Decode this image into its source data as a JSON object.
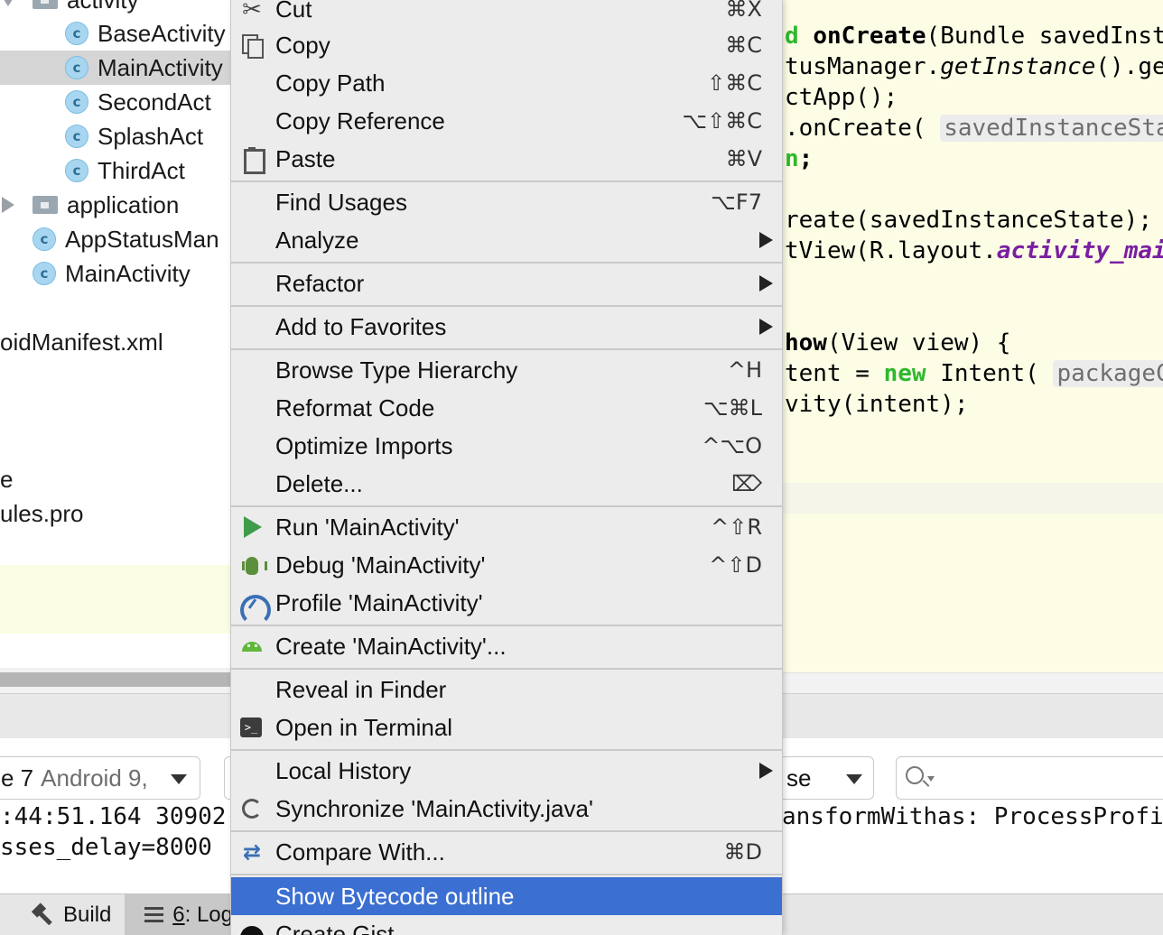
{
  "project_tree": {
    "rows": [
      {
        "label": "activity",
        "kind": "folder-open"
      },
      {
        "label": "BaseActivity",
        "kind": "class"
      },
      {
        "label": "MainActivity",
        "kind": "class"
      },
      {
        "label": "SecondAct",
        "kind": "class"
      },
      {
        "label": "SplashAct",
        "kind": "class"
      },
      {
        "label": "ThirdAct",
        "kind": "class"
      },
      {
        "label": "application",
        "kind": "folder-closed"
      },
      {
        "label": "AppStatusMan",
        "kind": "class"
      },
      {
        "label": "MainActivity",
        "kind": "class"
      },
      {
        "label": "oidManifest.xml",
        "kind": "file"
      },
      {
        "label": "e",
        "kind": "file"
      },
      {
        "label": "ules.pro",
        "kind": "file"
      }
    ],
    "class_icon_letter": "c"
  },
  "editor": {
    "lines": {
      "l1a": "d ",
      "l1b": "onCreate",
      "l1c": "(Bundle savedInst",
      "l2a": "tusManager.",
      "l2b": "getInstance",
      "l2c": "().ge",
      "l3": "ctApp();",
      "l4a": ".onCreate( ",
      "l4b": "savedInstanceState:",
      "l5a": "n",
      "l5b": ";",
      "l6": "reate(savedInstanceState);",
      "l7a": "tView(R.layout.",
      "l7b": "activity_mai",
      "l8a": "how",
      "l8b": "(View view) {",
      "l9a": "tent = ",
      "l9b": "new",
      "l9c": " Intent( ",
      "l9d": "packageC",
      "l10": "vity(intent);"
    }
  },
  "bottom_panel": {
    "device_name": "e 7",
    "device_api": "Android 9,",
    "process_label": "se",
    "log_line_1": ":44:51.164 30902-",
    "log_line_2": "sses_delay=8000",
    "log_line_right": "ansformWithas: ProcessProfi"
  },
  "toolbar": {
    "build": "Build",
    "logcat_num": "6",
    "logcat_rest": ": Log"
  },
  "context_menu": {
    "items": [
      {
        "label": "Cut",
        "shortcut": "⌘X"
      },
      {
        "label": "Copy",
        "shortcut": "⌘C"
      },
      {
        "label": "Copy Path",
        "shortcut": "⇧⌘C"
      },
      {
        "label": "Copy Reference",
        "shortcut": "⌥⇧⌘C"
      },
      {
        "label": "Paste",
        "shortcut": "⌘V"
      },
      {
        "label": "Find Usages",
        "shortcut": "⌥F7"
      },
      {
        "label": "Analyze",
        "shortcut": ""
      },
      {
        "label": "Refactor",
        "shortcut": ""
      },
      {
        "label": "Add to Favorites",
        "shortcut": ""
      },
      {
        "label": "Browse Type Hierarchy",
        "shortcut": "^H"
      },
      {
        "label": "Reformat Code",
        "shortcut": "⌥⌘L"
      },
      {
        "label": "Optimize Imports",
        "shortcut": "^⌥O"
      },
      {
        "label": "Delete...",
        "shortcut": "⌦"
      },
      {
        "label": "Run 'MainActivity'",
        "shortcut": "^⇧R"
      },
      {
        "label": "Debug 'MainActivity'",
        "shortcut": "^⇧D"
      },
      {
        "label": "Profile 'MainActivity'",
        "shortcut": ""
      },
      {
        "label": "Create 'MainActivity'...",
        "shortcut": ""
      },
      {
        "label": "Reveal in Finder",
        "shortcut": ""
      },
      {
        "label": "Open in Terminal",
        "shortcut": ""
      },
      {
        "label": "Local History",
        "shortcut": ""
      },
      {
        "label": "Synchronize 'MainActivity.java'",
        "shortcut": ""
      },
      {
        "label": "Compare With...",
        "shortcut": "⌘D"
      },
      {
        "label": "Show Bytecode outline",
        "shortcut": ""
      },
      {
        "label": "Create Gist...",
        "shortcut": ""
      }
    ],
    "highlighted": "Show Bytecode outline",
    "highlight_color": "#3b6fd1"
  },
  "colors": {
    "editor_background": "#fdfde6",
    "keyword": "#2eb82e",
    "field_italic": "#7a1fa2",
    "selected_tree_row": "#d5d5d5"
  }
}
